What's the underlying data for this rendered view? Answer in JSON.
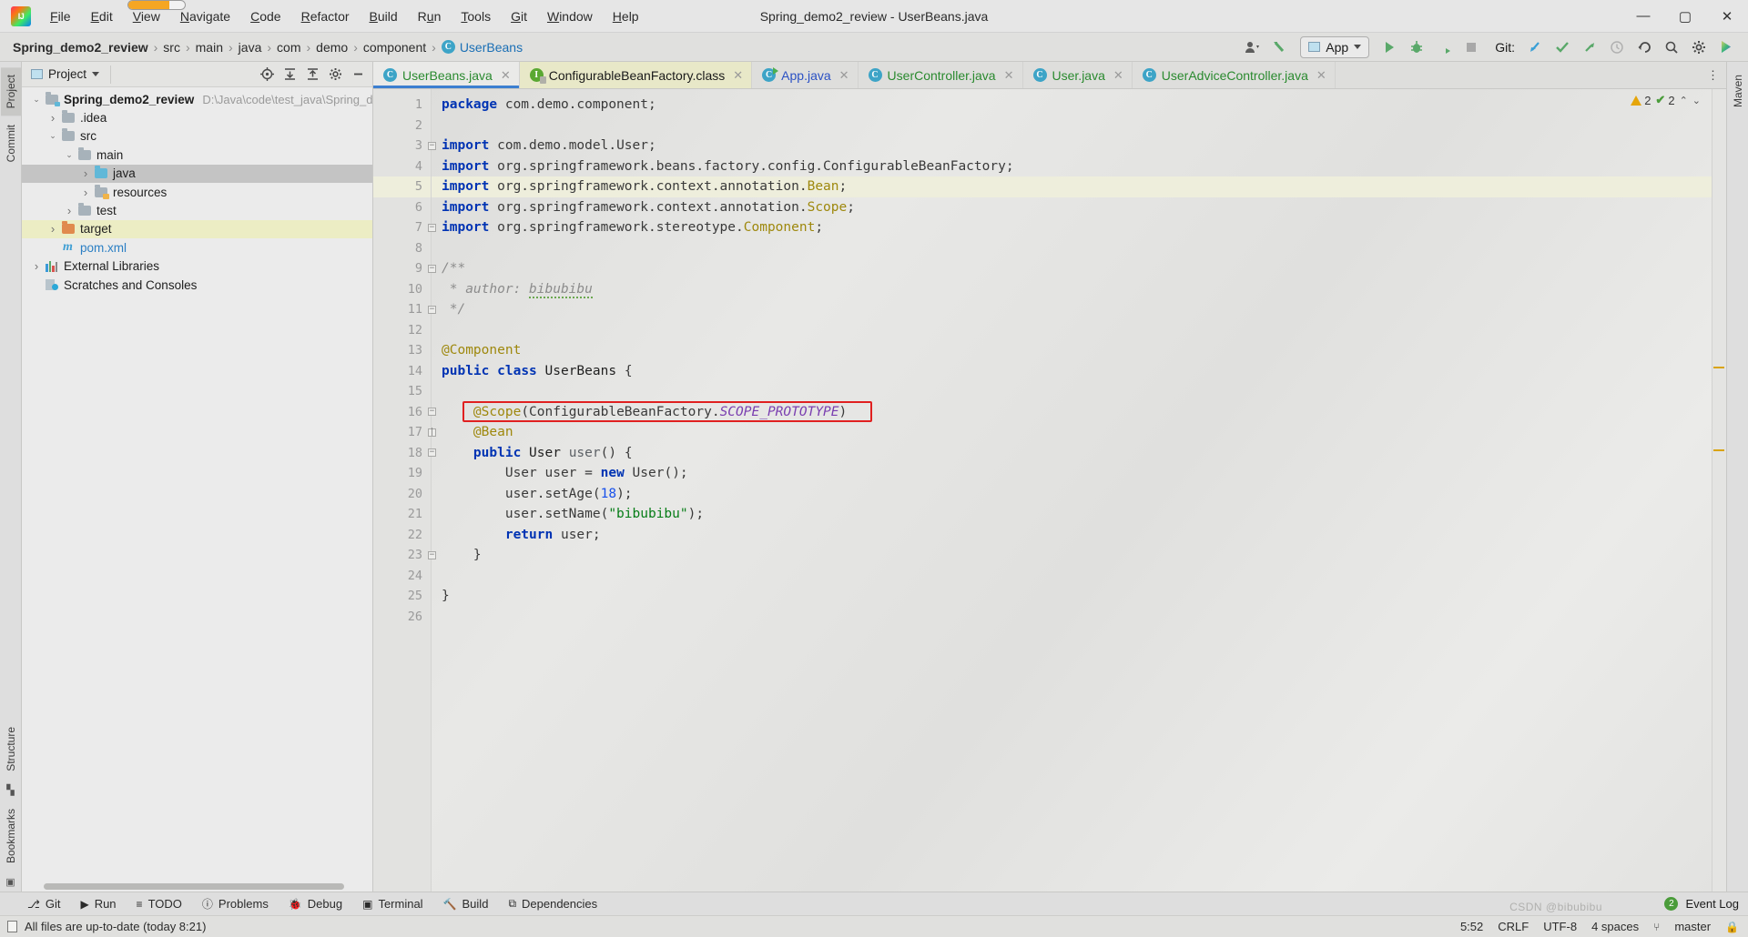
{
  "window": {
    "title": "Spring_demo2_review - UserBeans.java",
    "logo_text": "IJ",
    "minimize": "—",
    "maximize": "▢",
    "close": "✕"
  },
  "menu": {
    "items": [
      {
        "label": "File",
        "mnemonic": "F"
      },
      {
        "label": "Edit",
        "mnemonic": "E"
      },
      {
        "label": "View",
        "mnemonic": "V"
      },
      {
        "label": "Navigate",
        "mnemonic": "N"
      },
      {
        "label": "Code",
        "mnemonic": "C"
      },
      {
        "label": "Refactor",
        "mnemonic": "R"
      },
      {
        "label": "Build",
        "mnemonic": "B"
      },
      {
        "label": "Run",
        "mnemonic": "u"
      },
      {
        "label": "Tools",
        "mnemonic": "T"
      },
      {
        "label": "Git",
        "mnemonic": "G"
      },
      {
        "label": "Window",
        "mnemonic": "W"
      },
      {
        "label": "Help",
        "mnemonic": "H"
      }
    ]
  },
  "navbar": {
    "crumbs": [
      "Spring_demo2_review",
      "src",
      "main",
      "java",
      "com",
      "demo",
      "component"
    ],
    "separator": "›",
    "class_crumb": {
      "icon": "C",
      "label": "UserBeans"
    },
    "run_config": {
      "label": "App",
      "icon": "window-icon"
    },
    "git_label": "Git:",
    "icons": [
      {
        "name": "vcs-user-icon",
        "glyph": "👤"
      },
      {
        "name": "build-hammer-icon",
        "glyph": "↖"
      },
      {
        "name": "run-icon",
        "glyph": "▶"
      },
      {
        "name": "debug-icon",
        "glyph": "🐞"
      },
      {
        "name": "run-coverage-icon",
        "glyph": "◑"
      },
      {
        "name": "stop-icon",
        "glyph": "■"
      },
      {
        "name": "git-update-icon",
        "glyph": "↙"
      },
      {
        "name": "git-commit-icon",
        "glyph": "✔"
      },
      {
        "name": "git-push-icon",
        "glyph": "↗"
      },
      {
        "name": "git-history-icon",
        "glyph": "◴"
      },
      {
        "name": "git-rollback-icon",
        "glyph": "↶"
      },
      {
        "name": "search-icon",
        "glyph": "🔍"
      },
      {
        "name": "settings-gear-icon",
        "glyph": "⚙"
      },
      {
        "name": "ide-assistant-icon",
        "glyph": "◗"
      }
    ]
  },
  "left_rail": {
    "tabs": [
      "Project",
      "Commit",
      "Structure",
      "Bookmarks"
    ]
  },
  "right_rail": {
    "tabs": [
      "Maven"
    ]
  },
  "project_panel": {
    "title": "Project",
    "dropdown_caret": "▾",
    "actions": [
      {
        "name": "select-opened-file-icon",
        "glyph": "⊕"
      },
      {
        "name": "expand-all-icon",
        "glyph": "⨋"
      },
      {
        "name": "collapse-all-icon",
        "glyph": "⨌"
      },
      {
        "name": "settings-gear-icon",
        "glyph": "⚙"
      },
      {
        "name": "hide-panel-icon",
        "glyph": "—"
      }
    ],
    "tree": [
      {
        "label": "Spring_demo2_review",
        "path": "D:\\Java\\code\\test_java\\Spring_demo",
        "indent": 0,
        "arrow": "v",
        "icon": "module-folder",
        "bold": true,
        "state": "normal"
      },
      {
        "label": ".idea",
        "path": "",
        "indent": 1,
        "arrow": ">",
        "icon": "folder",
        "bold": false,
        "state": "normal"
      },
      {
        "label": "src",
        "path": "",
        "indent": 1,
        "arrow": "v",
        "icon": "folder",
        "bold": false,
        "state": "normal"
      },
      {
        "label": "main",
        "path": "",
        "indent": 2,
        "arrow": "v",
        "icon": "folder",
        "bold": false,
        "state": "normal"
      },
      {
        "label": "java",
        "path": "",
        "indent": 3,
        "arrow": ">",
        "icon": "source-folder",
        "bold": false,
        "state": "selected"
      },
      {
        "label": "resources",
        "path": "",
        "indent": 3,
        "arrow": ">",
        "icon": "resource-folder",
        "bold": false,
        "state": "normal"
      },
      {
        "label": "test",
        "path": "",
        "indent": 2,
        "arrow": ">",
        "icon": "folder",
        "bold": false,
        "state": "normal"
      },
      {
        "label": "target",
        "path": "",
        "indent": 1,
        "arrow": ">",
        "icon": "excluded-folder",
        "bold": false,
        "state": "highlight"
      },
      {
        "label": "pom.xml",
        "path": "",
        "indent": 1,
        "arrow": "",
        "icon": "maven-file",
        "bold": false,
        "state": "normal"
      },
      {
        "label": "External Libraries",
        "path": "",
        "indent": 0,
        "arrow": ">",
        "icon": "libraries",
        "bold": false,
        "state": "normal"
      },
      {
        "label": "Scratches and Consoles",
        "path": "",
        "indent": 0,
        "arrow": "",
        "icon": "scratches",
        "bold": false,
        "state": "normal"
      }
    ]
  },
  "editor_tabs": [
    {
      "label": "UserBeans.java",
      "icon": "java-class-icon",
      "icon_letter": "C",
      "color": "green",
      "active": true,
      "close": "✕"
    },
    {
      "label": "ConfigurableBeanFactory.class",
      "icon": "java-interface-icon",
      "icon_letter": "I",
      "color": "dark",
      "active": false,
      "close": "✕"
    },
    {
      "label": "App.java",
      "icon": "java-runnable-class-icon",
      "icon_letter": "C",
      "color": "blue",
      "active": false,
      "close": "✕"
    },
    {
      "label": "UserController.java",
      "icon": "java-class-icon",
      "icon_letter": "C",
      "color": "green",
      "active": false,
      "close": "✕"
    },
    {
      "label": "User.java",
      "icon": "java-class-icon",
      "icon_letter": "C",
      "color": "green",
      "active": false,
      "close": "✕"
    },
    {
      "label": "UserAdviceController.java",
      "icon": "java-class-icon",
      "icon_letter": "C",
      "color": "green",
      "active": false,
      "close": "✕"
    }
  ],
  "inspection": {
    "warnings_count": "2",
    "checks_count": "2",
    "warning_icon": "warning-triangle-icon",
    "check_icon": "check-icon",
    "up_arrow": "⌃",
    "down_arrow": "⌄"
  },
  "code": {
    "current_line": 5,
    "lines": [
      {
        "n": 1,
        "segments": [
          {
            "t": "package",
            "c": "k"
          },
          {
            "t": " com.demo.component;",
            "c": "pl"
          }
        ],
        "fold": ""
      },
      {
        "n": 2,
        "segments": [],
        "fold": ""
      },
      {
        "n": 3,
        "segments": [
          {
            "t": "import",
            "c": "k"
          },
          {
            "t": " com.demo.model.User;",
            "c": "pl"
          }
        ],
        "fold": "start"
      },
      {
        "n": 4,
        "segments": [
          {
            "t": "import",
            "c": "k"
          },
          {
            "t": " org.springframework.beans.factory.config.ConfigurableBeanFactory;",
            "c": "pl"
          }
        ],
        "fold": ""
      },
      {
        "n": 5,
        "segments": [
          {
            "t": "import",
            "c": "k"
          },
          {
            "t": " org.springframework.context.annotation.",
            "c": "pl"
          },
          {
            "t": "Bean",
            "c": "an"
          },
          {
            "t": ";",
            "c": "pl"
          }
        ],
        "fold": ""
      },
      {
        "n": 6,
        "segments": [
          {
            "t": "import",
            "c": "k"
          },
          {
            "t": " org.springframework.context.annotation.",
            "c": "pl"
          },
          {
            "t": "Scope",
            "c": "an"
          },
          {
            "t": ";",
            "c": "pl"
          }
        ],
        "fold": ""
      },
      {
        "n": 7,
        "segments": [
          {
            "t": "import",
            "c": "k"
          },
          {
            "t": " org.springframework.stereotype.",
            "c": "pl"
          },
          {
            "t": "Component",
            "c": "an"
          },
          {
            "t": ";",
            "c": "pl"
          }
        ],
        "fold": "end"
      },
      {
        "n": 8,
        "segments": [],
        "fold": ""
      },
      {
        "n": 9,
        "segments": [
          {
            "t": "/**",
            "c": "cm"
          }
        ],
        "fold": "start"
      },
      {
        "n": 10,
        "segments": [
          {
            "t": " * author: ",
            "c": "cm"
          },
          {
            "t": "bibubibu",
            "c": "cm-typo"
          }
        ],
        "fold": ""
      },
      {
        "n": 11,
        "segments": [
          {
            "t": " */",
            "c": "cm"
          }
        ],
        "fold": "end"
      },
      {
        "n": 12,
        "segments": [],
        "fold": ""
      },
      {
        "n": 13,
        "segments": [
          {
            "t": "@Component",
            "c": "an"
          }
        ],
        "fold": ""
      },
      {
        "n": 14,
        "segments": [
          {
            "t": "public",
            "c": "k"
          },
          {
            "t": " ",
            "c": "pl"
          },
          {
            "t": "class",
            "c": "k"
          },
          {
            "t": " ",
            "c": "pl"
          },
          {
            "t": "UserBeans",
            "c": "mf"
          },
          {
            "t": " {",
            "c": "pl"
          }
        ],
        "fold": ""
      },
      {
        "n": 15,
        "segments": [],
        "fold": ""
      },
      {
        "n": 16,
        "segments": [
          {
            "t": "    ",
            "c": "pl"
          },
          {
            "t": "@Scope",
            "c": "an"
          },
          {
            "t": "(ConfigurableBeanFactory.",
            "c": "pl"
          },
          {
            "t": "SCOPE_PROTOTYPE",
            "c": "sc"
          },
          {
            "t": ")",
            "c": "pl"
          }
        ],
        "fold": "start"
      },
      {
        "n": 17,
        "segments": [
          {
            "t": "    ",
            "c": "pl"
          },
          {
            "t": "@Bean",
            "c": "an"
          }
        ],
        "fold": "mid"
      },
      {
        "n": 18,
        "segments": [
          {
            "t": "    ",
            "c": "pl"
          },
          {
            "t": "public",
            "c": "k"
          },
          {
            "t": " ",
            "c": "pl"
          },
          {
            "t": "User",
            "c": "mf"
          },
          {
            "t": " ",
            "c": "pl"
          },
          {
            "t": "user",
            "c": "cl"
          },
          {
            "t": "() {",
            "c": "pl"
          }
        ],
        "fold": "start2"
      },
      {
        "n": 19,
        "segments": [
          {
            "t": "        User user = ",
            "c": "pl"
          },
          {
            "t": "new",
            "c": "k"
          },
          {
            "t": " User();",
            "c": "pl"
          }
        ],
        "fold": ""
      },
      {
        "n": 20,
        "segments": [
          {
            "t": "        user.setAge(",
            "c": "pl"
          },
          {
            "t": "18",
            "c": "nu"
          },
          {
            "t": ");",
            "c": "pl"
          }
        ],
        "fold": ""
      },
      {
        "n": 21,
        "segments": [
          {
            "t": "        user.setName(",
            "c": "pl"
          },
          {
            "t": "\"bibubibu\"",
            "c": "st"
          },
          {
            "t": ");",
            "c": "pl"
          }
        ],
        "fold": ""
      },
      {
        "n": 22,
        "segments": [
          {
            "t": "        ",
            "c": "pl"
          },
          {
            "t": "return",
            "c": "k"
          },
          {
            "t": " user;",
            "c": "pl"
          }
        ],
        "fold": ""
      },
      {
        "n": 23,
        "segments": [
          {
            "t": "    }",
            "c": "pl"
          }
        ],
        "fold": "end2"
      },
      {
        "n": 24,
        "segments": [],
        "fold": ""
      },
      {
        "n": 25,
        "segments": [
          {
            "t": "}",
            "c": "pl"
          }
        ],
        "fold": ""
      },
      {
        "n": 26,
        "segments": [],
        "fold": ""
      }
    ],
    "highlight_box": {
      "line": 16,
      "label": "scope-prototype-highlight"
    }
  },
  "bottom_bar": {
    "items": [
      {
        "label": "Git",
        "icon": "git-branch-icon",
        "glyph": "⎇"
      },
      {
        "label": "Run",
        "icon": "run-icon",
        "glyph": "▶"
      },
      {
        "label": "TODO",
        "icon": "todo-icon",
        "glyph": "≡"
      },
      {
        "label": "Problems",
        "icon": "problems-icon",
        "glyph": "ⓘ"
      },
      {
        "label": "Debug",
        "icon": "debug-icon",
        "glyph": "🐞"
      },
      {
        "label": "Terminal",
        "icon": "terminal-icon",
        "glyph": "▣"
      },
      {
        "label": "Build",
        "icon": "build-icon",
        "glyph": "🔨"
      },
      {
        "label": "Dependencies",
        "icon": "dependencies-icon",
        "glyph": "⧉"
      }
    ],
    "event_log": {
      "label": "Event Log",
      "badge": "2"
    }
  },
  "status_bar": {
    "message": "All files are up-to-date (today 8:21)",
    "caret_position": "5:52",
    "line_separator": "CRLF",
    "encoding": "UTF-8",
    "indent": "4 spaces",
    "branch": "master",
    "branch_icon": "git-branch-icon",
    "lock_icon": "lock-icon",
    "watermark": "CSDN @bibubibu"
  }
}
